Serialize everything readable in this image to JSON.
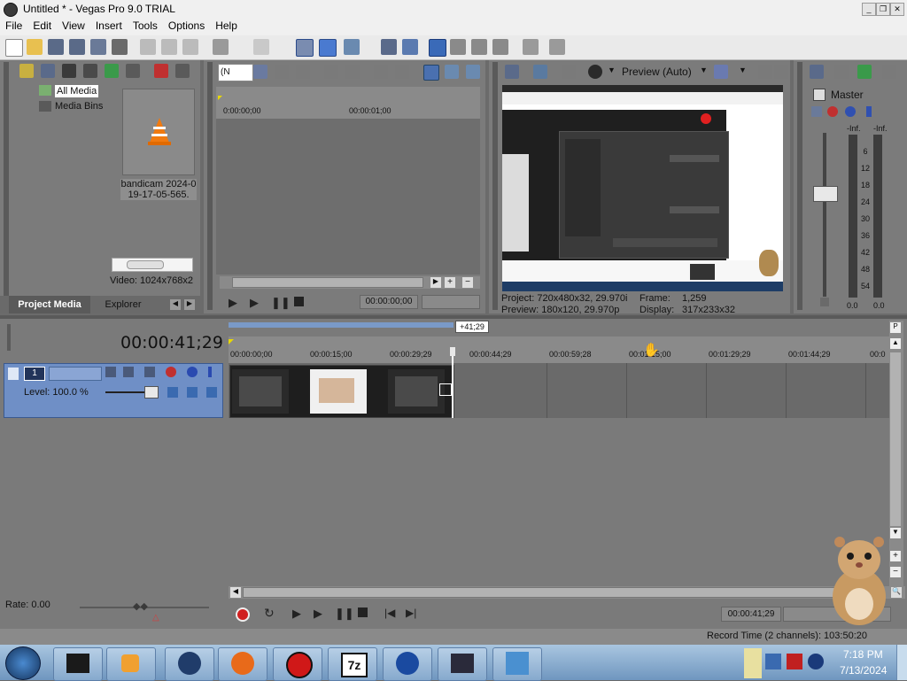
{
  "window": {
    "title": "Untitled * - Vegas Pro 9.0 TRIAL"
  },
  "menu": [
    "File",
    "Edit",
    "View",
    "Insert",
    "Tools",
    "Options",
    "Help"
  ],
  "project_media": {
    "tree": [
      "All Media",
      "Media Bins"
    ],
    "file_name_line1": "bandicam 2024-0",
    "file_name_line2": "19-17-05-565.",
    "video_info": "Video: 1024x768x2",
    "tabs": [
      "Project Media",
      "Explorer"
    ]
  },
  "trimmer": {
    "zoom_select": "(N",
    "ruler": [
      "0:00:00;00",
      "00:00:01;00"
    ],
    "timecode": "00:00:00;00"
  },
  "preview": {
    "mode": "Preview (Auto)",
    "project": "Project: 720x480x32, 29.970i",
    "preview": "Preview: 180x120, 29.970p",
    "frame_label": "Frame:",
    "frame_value": "1,259",
    "display_label": "Display:",
    "display_value": "317x233x32"
  },
  "master": {
    "title": "Master",
    "left_label": "-Inf.",
    "right_label": "-Inf.",
    "scale": [
      "6",
      "12",
      "18",
      "24",
      "30",
      "36",
      "42",
      "48",
      "54"
    ],
    "bottom_left": "0.0",
    "bottom_right": "0.0"
  },
  "timeline": {
    "timecode": "00:00:41;29",
    "cursor_badge": "+41;29",
    "ruler": [
      "00:00:00;00",
      "00:00:15;00",
      "00:00:29;29",
      "00:00:44;29",
      "00:00:59;28",
      "00:01:15;00",
      "00:01:29;29",
      "00:01:44;29",
      "00:0"
    ],
    "track_number": "1",
    "level": "Level: 100.0 %"
  },
  "transport": {
    "rate": "Rate: 0.00",
    "timecode": "00:00:41;29",
    "record_time": "Record Time (2 channels): 103:50:20"
  },
  "taskbar": {
    "time": "7:18 PM",
    "date": "7/13/2024",
    "apps": [
      "media-player",
      "vegas",
      "firefox",
      "bandicam",
      "7zip",
      "camera",
      "vegas-video",
      "movie-maker"
    ]
  },
  "colors": {
    "panel": "#7b7b7b",
    "track_header": "#6f8fc6",
    "accent": "#3070c0",
    "taskbar": "#8fb2d6"
  }
}
